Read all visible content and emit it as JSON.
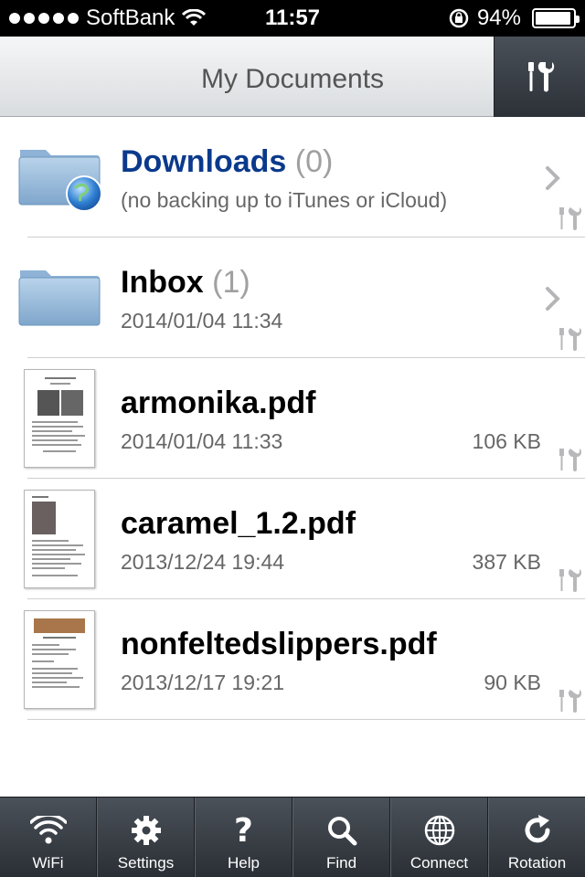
{
  "status": {
    "carrier": "SoftBank",
    "time": "11:57",
    "battery": "94%",
    "battery_level": 0.94
  },
  "nav": {
    "title": "My Documents"
  },
  "items": [
    {
      "name": "Downloads",
      "count": "(0)",
      "sub": "(no backing up to iTunes or iCloud)",
      "size": ""
    },
    {
      "name": "Inbox",
      "count": "(1)",
      "sub": "2014/01/04 11:34",
      "size": ""
    },
    {
      "name": "armonika.pdf",
      "count": "",
      "sub": "2014/01/04 11:33",
      "size": "106 KB"
    },
    {
      "name": "caramel_1.2.pdf",
      "count": "",
      "sub": "2013/12/24 19:44",
      "size": "387 KB"
    },
    {
      "name": "nonfeltedslippers.pdf",
      "count": "",
      "sub": "2013/12/17 19:21",
      "size": "90 KB"
    }
  ],
  "tabs": [
    {
      "label": "WiFi",
      "icon": "wifi-icon"
    },
    {
      "label": "Settings",
      "icon": "gear-icon"
    },
    {
      "label": "Help",
      "icon": "help-icon"
    },
    {
      "label": "Find",
      "icon": "search-icon"
    },
    {
      "label": "Connect",
      "icon": "globe-icon"
    },
    {
      "label": "Rotation",
      "icon": "rotate-icon"
    }
  ],
  "colors": {
    "folder_name_blue": "#0b3a8c",
    "toolbar_dark": "#2c3138"
  }
}
